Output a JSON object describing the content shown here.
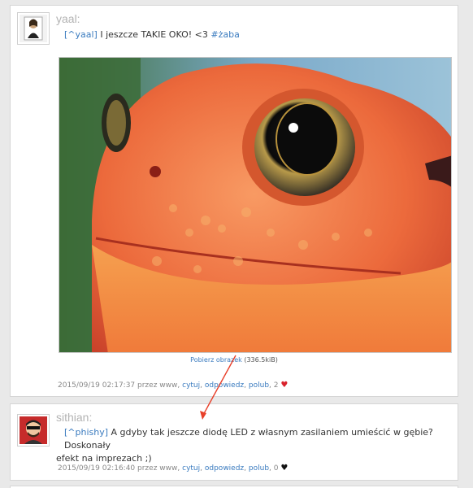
{
  "posts": [
    {
      "author": "yaal:",
      "mention": "[^yaal]",
      "text": " I jeszcze TAKIE OKO! <3 ",
      "hashtag": "#żaba",
      "download": {
        "label": "Pobierz obrazek",
        "size": "(336.5kiB)"
      },
      "meta": {
        "timestamp": "2015/09/19 02:17:37 przez",
        "via": "www",
        "actions": [
          "cytuj",
          "odpowiedz",
          "polub"
        ],
        "likes": "2"
      }
    },
    {
      "author": "sithian:",
      "mention": "[^phishy]",
      "text_line1": " A gdyby tak jeszcze diodę LED z własnym zasilaniem umieścić w gębie? Doskonały",
      "text_line2": "efekt na imprezach ;)",
      "meta": {
        "timestamp": "2015/09/19 02:16:40 przez",
        "via": "www",
        "actions": [
          "cytuj",
          "odpowiedz",
          "polub"
        ],
        "likes": "0"
      }
    }
  ],
  "colors": {
    "link": "#3a7bbf",
    "heart_liked": "#d9232d",
    "heart_default": "#111111",
    "annotation_arrow": "#e8402a"
  }
}
